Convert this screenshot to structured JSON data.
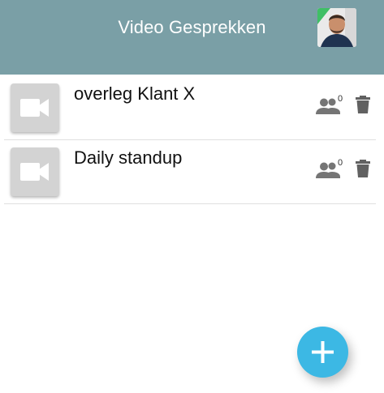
{
  "header": {
    "title": "Video Gesprekken"
  },
  "list": [
    {
      "title": "overleg Klant X",
      "participants": "0"
    },
    {
      "title": "Daily standup",
      "participants": "0"
    }
  ],
  "colors": {
    "header_bg": "#7a9fa6",
    "fab": "#3cb8e4",
    "thumb": "#d3d3d3"
  },
  "icons": {
    "thumbnail": "video-camera-icon",
    "participants": "people-icon",
    "delete": "trash-icon",
    "fab": "plus-icon"
  }
}
